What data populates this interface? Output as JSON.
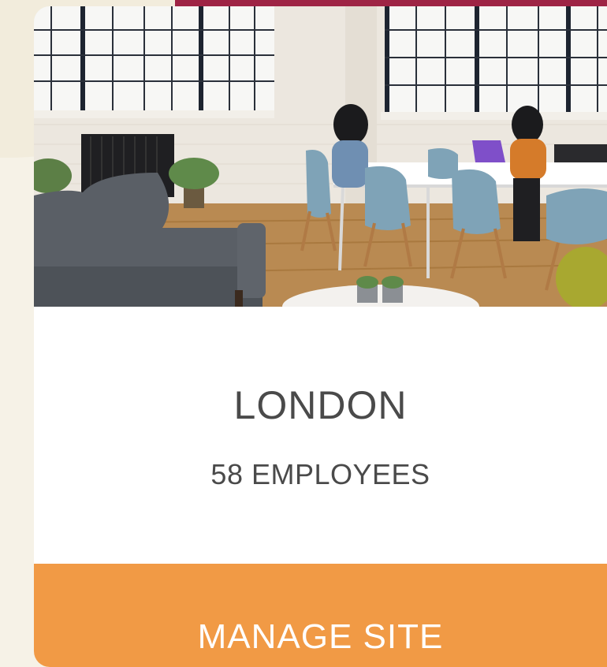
{
  "site_card": {
    "photo_alt": "Office interior with sofa, meeting table and two people working",
    "site_name": "LONDON",
    "employee_count": "58 EMPLOYEES",
    "manage_label": "MANAGE SITE"
  },
  "colors": {
    "page_background": "#f6f2e7",
    "top_accent": "#9e2445",
    "card_background": "#ffffff",
    "button_background": "#f19a45",
    "button_text": "#ffffff",
    "text_primary": "#4a4a4a"
  }
}
